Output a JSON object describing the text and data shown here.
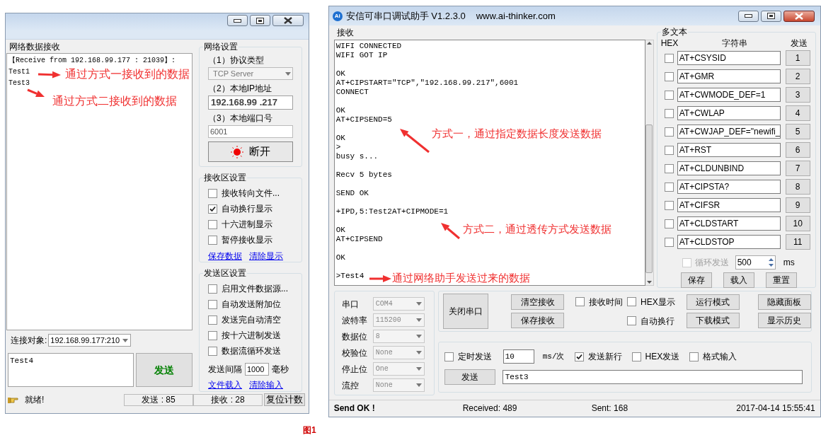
{
  "net_window": {
    "receive_title": "网络数据接收",
    "receive_text": "【Receive from 192.168.99.177 : 21039】:\nTest1\nTest3",
    "annotations": [
      {
        "text": "通过方式一接收到的数据"
      },
      {
        "text": "通过方式二接收到的数据"
      }
    ],
    "target_label": "连接对象:",
    "target_value": "192.168.99.177:210",
    "send_text": "Test4",
    "send_button": "发送",
    "settings_title": "网络设置",
    "protocol_label": "（1）协议类型",
    "protocol_value": "TCP Server",
    "protocol_disabled": true,
    "ip_label": "（2）本地IP地址",
    "ip_value": "192.168.99 .217",
    "port_label": "（3）本地端口号",
    "port_value": "6001",
    "connect_button": "断开",
    "receive_settings": {
      "title": "接收区设置",
      "options": [
        {
          "label": "接收转向文件...",
          "checked": false
        },
        {
          "label": "自动换行显示",
          "checked": true
        },
        {
          "label": "十六进制显示",
          "checked": false
        },
        {
          "label": "暂停接收显示",
          "checked": false
        }
      ],
      "links": [
        "保存数据",
        "清除显示"
      ]
    },
    "send_settings": {
      "title": "发送区设置",
      "options": [
        {
          "label": "启用文件数据源...",
          "checked": false
        },
        {
          "label": "自动发送附加位",
          "checked": false
        },
        {
          "label": "发送完自动清空",
          "checked": false
        },
        {
          "label": "按十六进制发送",
          "checked": false
        },
        {
          "label": "数据流循环发送",
          "checked": false
        }
      ],
      "interval_label": "发送间隔",
      "interval_value": "1000",
      "interval_unit": "毫秒",
      "links": [
        "文件载入",
        "清除输入"
      ]
    },
    "status": {
      "text": "就绪!",
      "sent": "发送 : 85",
      "received": "接收 : 28",
      "reset_button": "复位计数"
    }
  },
  "serial_window": {
    "logo_text": "Ai",
    "title": "安信可串口调试助手 V1.2.3.0",
    "url": "www.ai-thinker.com",
    "receive_title": "接收",
    "receive_text": "WIFI CONNECTED\nWIFI GOT IP\n\nOK\nAT+CIPSTART=\"TCP\",\"192.168.99.217\",6001\nCONNECT\n\nOK\nAT+CIPSEND=5\n\nOK\n>\nbusy s...\n\nRecv 5 bytes\n\nSEND OK\n\n+IPD,5:Test2AT+CIPMODE=1\n\nOK\nAT+CIPSEND\n\nOK\n\n>Test4",
    "annotations": [
      {
        "text": "方式一，通过指定数据长度发送数据"
      },
      {
        "text": "方式二，通过透传方式发送数据"
      },
      {
        "text": "通过网络助手发送过来的数据"
      }
    ],
    "multi": {
      "title": "多文本",
      "col_hex": "HEX",
      "col_string": "字符串",
      "col_send": "发送",
      "rows": [
        {
          "hex": false,
          "text": "AT+CSYSID",
          "button": "1"
        },
        {
          "hex": false,
          "text": "AT+GMR",
          "button": "2"
        },
        {
          "hex": false,
          "text": "AT+CWMODE_DEF=1",
          "button": "3"
        },
        {
          "hex": false,
          "text": "AT+CWLAP",
          "button": "4"
        },
        {
          "hex": false,
          "text": "AT+CWJAP_DEF=\"newifi_",
          "button": "5"
        },
        {
          "hex": false,
          "text": "AT+RST",
          "button": "6"
        },
        {
          "hex": false,
          "text": "AT+CLDUNBIND",
          "button": "7"
        },
        {
          "hex": false,
          "text": "AT+CIPSTA?",
          "button": "8"
        },
        {
          "hex": false,
          "text": "AT+CIFSR",
          "button": "9"
        },
        {
          "hex": false,
          "text": "AT+CLDSTART",
          "button": "10"
        },
        {
          "hex": false,
          "text": "AT+CLDSTOP",
          "button": "11"
        }
      ],
      "loop_label": "循环发送",
      "loop_checked": false,
      "loop_disabled": true,
      "loop_value": "500",
      "loop_unit": "ms",
      "buttons": [
        "保存",
        "载入",
        "重置"
      ]
    },
    "port_settings": [
      {
        "label": "串口",
        "value": "COM4",
        "disabled": true
      },
      {
        "label": "波特率",
        "value": "115200",
        "disabled": true
      },
      {
        "label": "数据位",
        "value": "8",
        "disabled": true
      },
      {
        "label": "校验位",
        "value": "None",
        "disabled": true
      },
      {
        "label": "停止位",
        "value": "One",
        "disabled": true
      },
      {
        "label": "流控",
        "value": "None",
        "disabled": true
      }
    ],
    "control_panel": {
      "close_port": "关闭串口",
      "receive_buttons": [
        "清空接收",
        "保存接收"
      ],
      "options": [
        {
          "label": "接收时间",
          "checked": false
        },
        {
          "label": "HEX显示",
          "checked": false
        },
        {
          "label": "自动换行",
          "checked": false
        }
      ],
      "mode_buttons": [
        "运行模式",
        "下载模式"
      ],
      "panel_buttons": [
        "隐藏面板",
        "显示历史"
      ]
    },
    "send_panel": {
      "timer": {
        "label": "定时发送",
        "checked": false
      },
      "period_value": "10",
      "period_unit": "ms/次",
      "options": [
        {
          "label": "发送新行",
          "checked": true
        },
        {
          "label": "HEX发送",
          "checked": false
        },
        {
          "label": "格式输入",
          "checked": false
        }
      ],
      "send_button": "发送",
      "send_value": "Test3"
    },
    "status": {
      "message": "Send OK !",
      "received": "Received: 489",
      "sent": "Sent: 168",
      "time": "2017-04-14 15:55:41"
    }
  },
  "caption": "图1"
}
